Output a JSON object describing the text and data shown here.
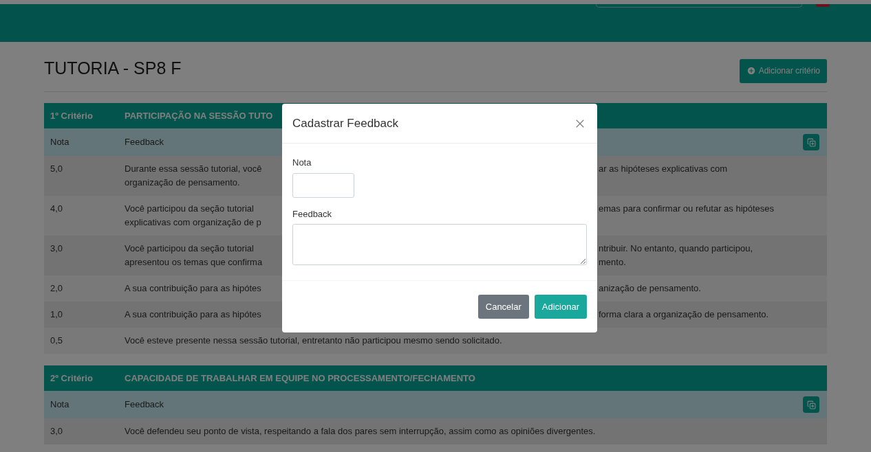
{
  "page": {
    "title": "TUTORIA - SP8 F",
    "add_button": "Adicionar critério"
  },
  "criteria": [
    {
      "label": "1º Critério",
      "title": "PARTICIPAÇÃO NA SESSÃO TUTO",
      "columns": [
        "Nota",
        "Feedback"
      ],
      "rows": [
        {
          "nota": "5,0",
          "left": [
            "Durante essa sessão tutorial, você",
            "organização de pensamento."
          ],
          "right": [
            "ar as hipóteses explicativas com"
          ]
        },
        {
          "nota": "4,0",
          "left": [
            "Você participou da seção tutorial",
            "explicativas com organização de p"
          ],
          "right": [
            "emas para confirmar ou refutar as hipóteses"
          ]
        },
        {
          "nota": "3,0",
          "left": [
            "Você participou da seção tutorial",
            "apresentou os temas que confirma"
          ],
          "right": [
            "ntribuir. No entanto, quando participou,",
            "mento."
          ]
        },
        {
          "nota": "2,0",
          "left": [
            "A sua contribuição para as hipótes"
          ],
          "right": [
            "anização de pensamento."
          ]
        },
        {
          "nota": "1,0",
          "left": [
            "A sua contribuição para as hipótes"
          ],
          "right": [
            "forma clara a organização de pensamento."
          ]
        },
        {
          "nota": "0,5",
          "text": "Você esteve presente nessa sessão tutorial, entretanto não participou mesmo sendo solicitado."
        }
      ]
    },
    {
      "label": "2º Critério",
      "title": "CAPACIDADE DE TRABALHAR EM EQUIPE NO PROCESSAMENTO/FECHAMENTO",
      "columns": [
        "Nota",
        "Feedback"
      ],
      "rows": [
        {
          "nota": "3,0",
          "text": "Você defendeu seu ponto de vista, respeitando a fala dos pares sem interrupção, assim como as opiniões divergentes."
        }
      ]
    }
  ],
  "modal": {
    "title": "Cadastrar Feedback",
    "fields": [
      {
        "label": "Nota",
        "kind": "input"
      },
      {
        "label": "Feedback",
        "kind": "textarea"
      }
    ],
    "buttons": [
      {
        "label": "Cancelar",
        "kind": "secondary"
      },
      {
        "label": "Adicionar",
        "kind": "primary"
      }
    ]
  }
}
